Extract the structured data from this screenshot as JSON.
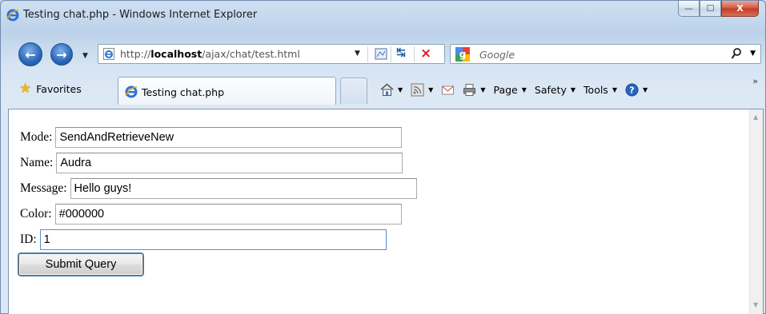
{
  "window": {
    "title": "Testing chat.php - Windows Internet Explorer",
    "buttons": {
      "minimize": "—",
      "maximize": "☐",
      "close": "X"
    }
  },
  "navbar": {
    "url_prefix": "http://",
    "url_host": "localhost",
    "url_path": "/ajax/chat/test.html",
    "search_placeholder": "Google"
  },
  "cmdbar": {
    "favorites_label": "Favorites",
    "tab_label": "Testing chat.php",
    "page_label": "Page",
    "safety_label": "Safety",
    "tools_label": "Tools",
    "more": "»"
  },
  "form": {
    "mode": {
      "label": "Mode:",
      "value": "SendAndRetrieveNew"
    },
    "name": {
      "label": "Name:",
      "value": "Audra"
    },
    "message": {
      "label": "Message:",
      "value": "Hello guys!"
    },
    "color": {
      "label": "Color:",
      "value": "#000000"
    },
    "id": {
      "label": "ID:",
      "value": "1"
    },
    "submit_label": "Submit Query"
  },
  "colors": {
    "chrome_blue": "#bcd2ea",
    "close_red": "#c23b22",
    "focus_blue": "#5a8fd0"
  },
  "icons": [
    "ie-icon",
    "back-icon",
    "forward-icon",
    "compat-view-icon",
    "refresh-icon",
    "stop-icon",
    "google-icon",
    "search-icon",
    "star-icon",
    "home-icon",
    "rss-icon",
    "mail-icon",
    "print-icon",
    "help-icon"
  ]
}
